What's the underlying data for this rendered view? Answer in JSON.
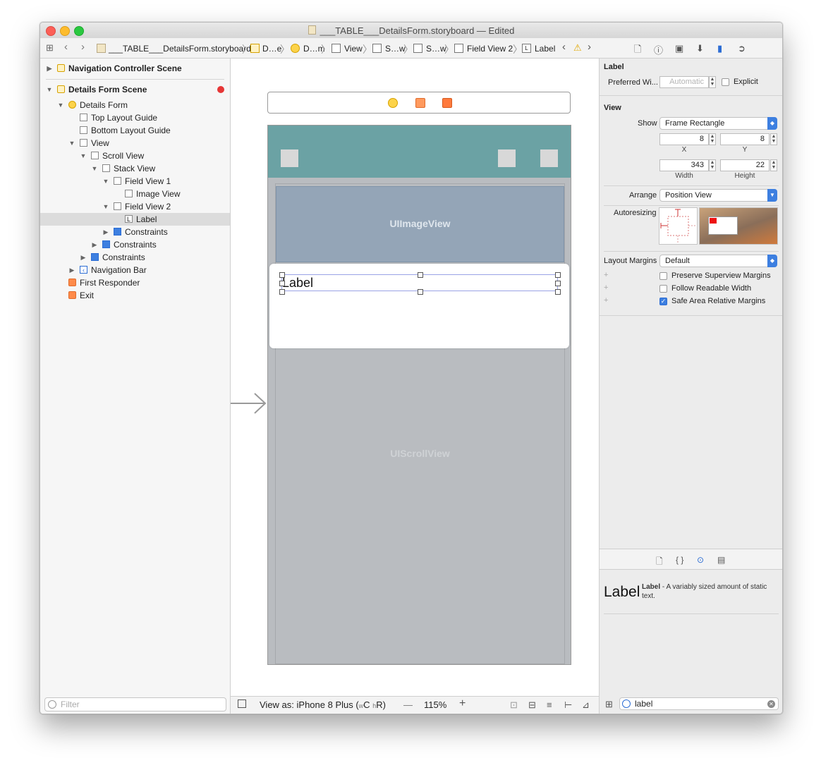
{
  "window": {
    "title": "___TABLE___DetailsForm.storyboard — Edited"
  },
  "jumpbar": {
    "items": [
      "___TABLE___DetailsForm.storyboard",
      "D…e",
      "D…m",
      "View",
      "S…w",
      "S…w",
      "Field View 2",
      "Label"
    ]
  },
  "navigator": {
    "items": [
      {
        "label": "Navigation Controller Scene"
      },
      {
        "label": "Details Form Scene"
      },
      {
        "label": "Details Form"
      },
      {
        "label": "Top Layout Guide"
      },
      {
        "label": "Bottom Layout Guide"
      },
      {
        "label": "View"
      },
      {
        "label": "Scroll View"
      },
      {
        "label": "Stack View"
      },
      {
        "label": "Field View 1"
      },
      {
        "label": "Image View"
      },
      {
        "label": "Field View 2"
      },
      {
        "label": "Label"
      },
      {
        "label": "Constraints"
      },
      {
        "label": "Constraints"
      },
      {
        "label": "Constraints"
      },
      {
        "label": "Navigation Bar"
      },
      {
        "label": "First Responder"
      },
      {
        "label": "Exit"
      }
    ],
    "filter_placeholder": "Filter"
  },
  "canvas": {
    "image_view_label": "UIImageView",
    "scroll_view_label": "UIScrollView",
    "label_text": "Label"
  },
  "bottombar": {
    "view_as_prefix": "View as: iPhone 8 Plus (",
    "size_w": "w",
    "size_c": "C",
    "size_h": "h",
    "size_r": "R",
    "view_as_suffix": ")",
    "zoom": "115%"
  },
  "inspector": {
    "label_section": "Label",
    "preferred_width_label": "Preferred Wi...",
    "preferred_width_placeholder": "Automatic",
    "explicit_label": "Explicit",
    "view_section": "View",
    "show_label": "Show",
    "show_value": "Frame Rectangle",
    "x_value": "8",
    "y_value": "8",
    "x_caption": "X",
    "y_caption": "Y",
    "width_value": "343",
    "height_value": "22",
    "width_caption": "Width",
    "height_caption": "Height",
    "arrange_label": "Arrange",
    "arrange_value": "Position View",
    "autoresizing_label": "Autoresizing",
    "layout_margins_label": "Layout Margins",
    "layout_margins_value": "Default",
    "preserve_label": "Preserve Superview Margins",
    "readable_label": "Follow Readable Width",
    "safe_area_label": "Safe Area Relative Margins"
  },
  "library": {
    "item_big": "Label",
    "item_name": "Label",
    "item_desc": " - A variably sized amount of static text.",
    "search_value": "label"
  },
  "colors": {
    "nav_bar": "#6ba2a4",
    "image_view": "#94a5b7",
    "scroll_view": "#b9bcc0",
    "accent": "#3d7fe0"
  }
}
